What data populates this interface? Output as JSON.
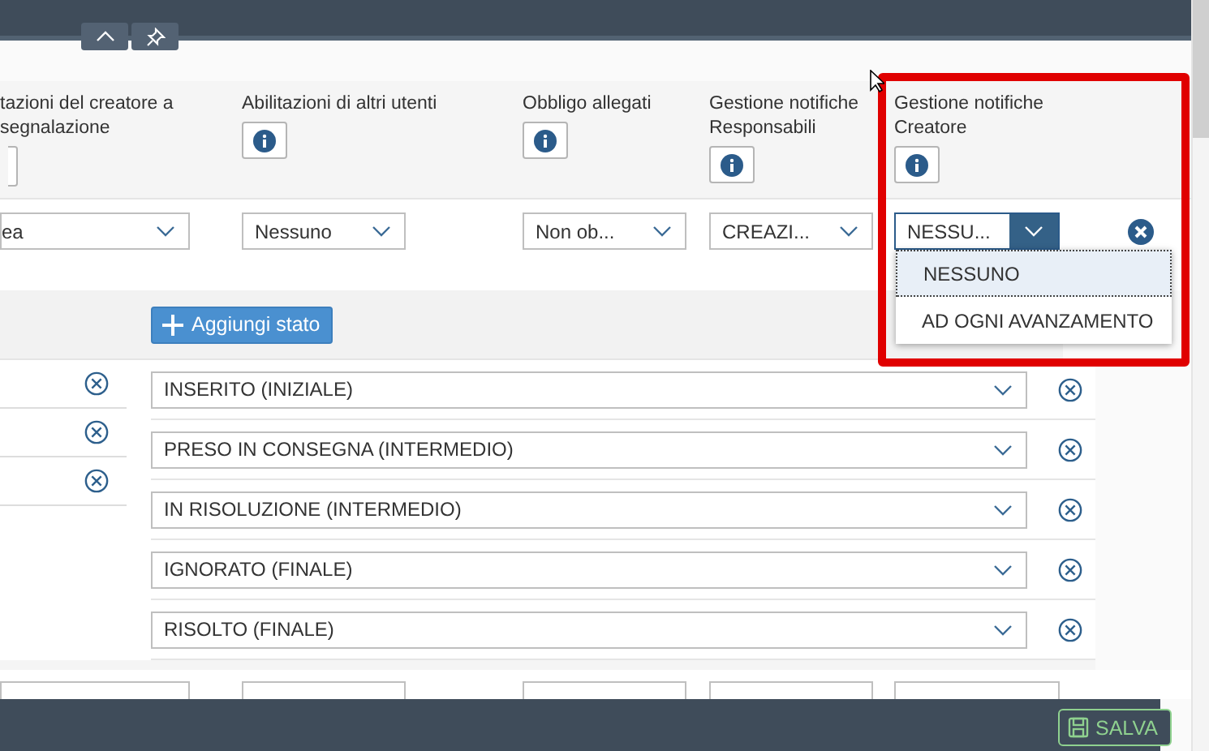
{
  "toolbar": {
    "buttons": [
      {
        "kind": "collapse"
      },
      {
        "kind": "pin"
      }
    ]
  },
  "columns": [
    {
      "label": "tazioni del creatore a segnalazione"
    },
    {
      "label": "Abilitazioni di altri utenti"
    },
    {
      "label": "Obbligo allegati"
    },
    {
      "label": "Gestione notifiche Responsabili"
    },
    {
      "label": "Gestione notifiche Creatore"
    }
  ],
  "rule_row": {
    "values": [
      {
        "value": "ea",
        "open": false
      },
      {
        "value": "Nessuno",
        "open": false
      },
      {
        "value": "Non ob...",
        "open": false
      },
      {
        "value": "CREAZI...",
        "open": false
      },
      {
        "value": "NESSU...",
        "open": true
      }
    ]
  },
  "dropdown": {
    "options": [
      {
        "label": "NESSUNO",
        "selected": true
      },
      {
        "label": "AD OGNI AVANZAMENTO",
        "selected": false
      }
    ]
  },
  "add_state_button": {
    "label": "Aggiungi stato"
  },
  "left_rows": [
    {
      "kind": "removable"
    },
    {
      "kind": "removable"
    },
    {
      "kind": "removable"
    }
  ],
  "states": [
    {
      "value": "INSERITO (INIZIALE)"
    },
    {
      "value": "PRESO IN CONSEGNA (INTERMEDIO)"
    },
    {
      "value": "IN RISOLUZIONE (INTERMEDIO)"
    },
    {
      "value": "IGNORATO (FINALE)"
    },
    {
      "value": "RISOLTO (FINALE)"
    }
  ],
  "next_row": {
    "fields": [
      {
        "kind": "dropdown"
      },
      {
        "kind": "dropdown"
      },
      {
        "kind": "dropdown"
      },
      {
        "kind": "dropdown"
      },
      {
        "kind": "dropdown"
      }
    ]
  },
  "footer": {
    "save_button": {
      "label": "SALVA"
    }
  }
}
